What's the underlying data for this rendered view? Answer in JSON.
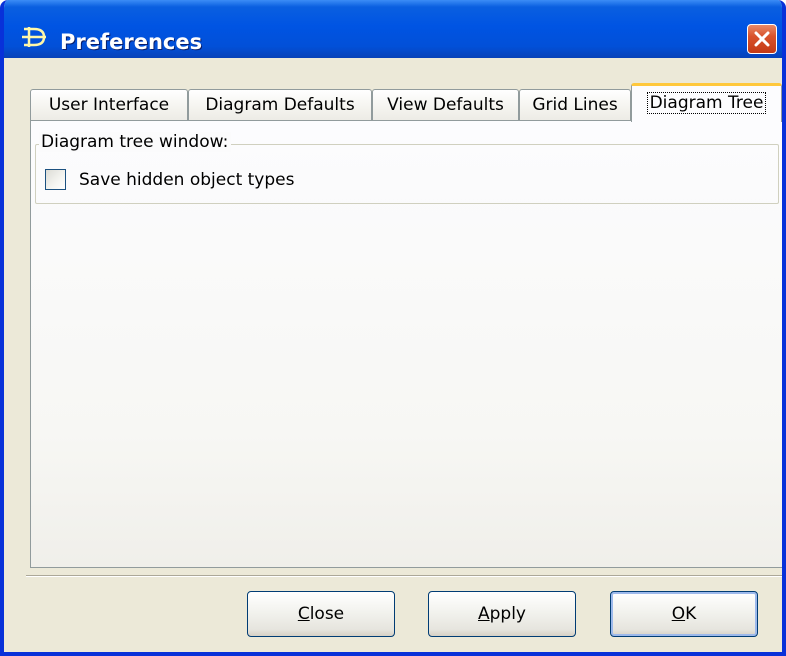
{
  "window": {
    "title": "Preferences",
    "close_label": "close-window"
  },
  "tabs": [
    {
      "label": "User Interface",
      "active": false
    },
    {
      "label": "Diagram Defaults",
      "active": false
    },
    {
      "label": "View Defaults",
      "active": false
    },
    {
      "label": "Grid Lines",
      "active": false
    },
    {
      "label": "Diagram Tree",
      "active": true
    }
  ],
  "diagram_tree": {
    "group_title": "Diagram tree window:",
    "save_hidden_label": "Save hidden object types",
    "save_hidden_checked": false
  },
  "buttons": {
    "close": {
      "mnemonic": "C",
      "rest": "lose"
    },
    "apply": {
      "mnemonic": "A",
      "rest": "pply"
    },
    "ok": {
      "mnemonic": "O",
      "rest": "K"
    }
  },
  "colors": {
    "titlebar": "#0054e3",
    "tab_highlight": "#ffc83c",
    "dialog_bg": "#ece9d8"
  }
}
